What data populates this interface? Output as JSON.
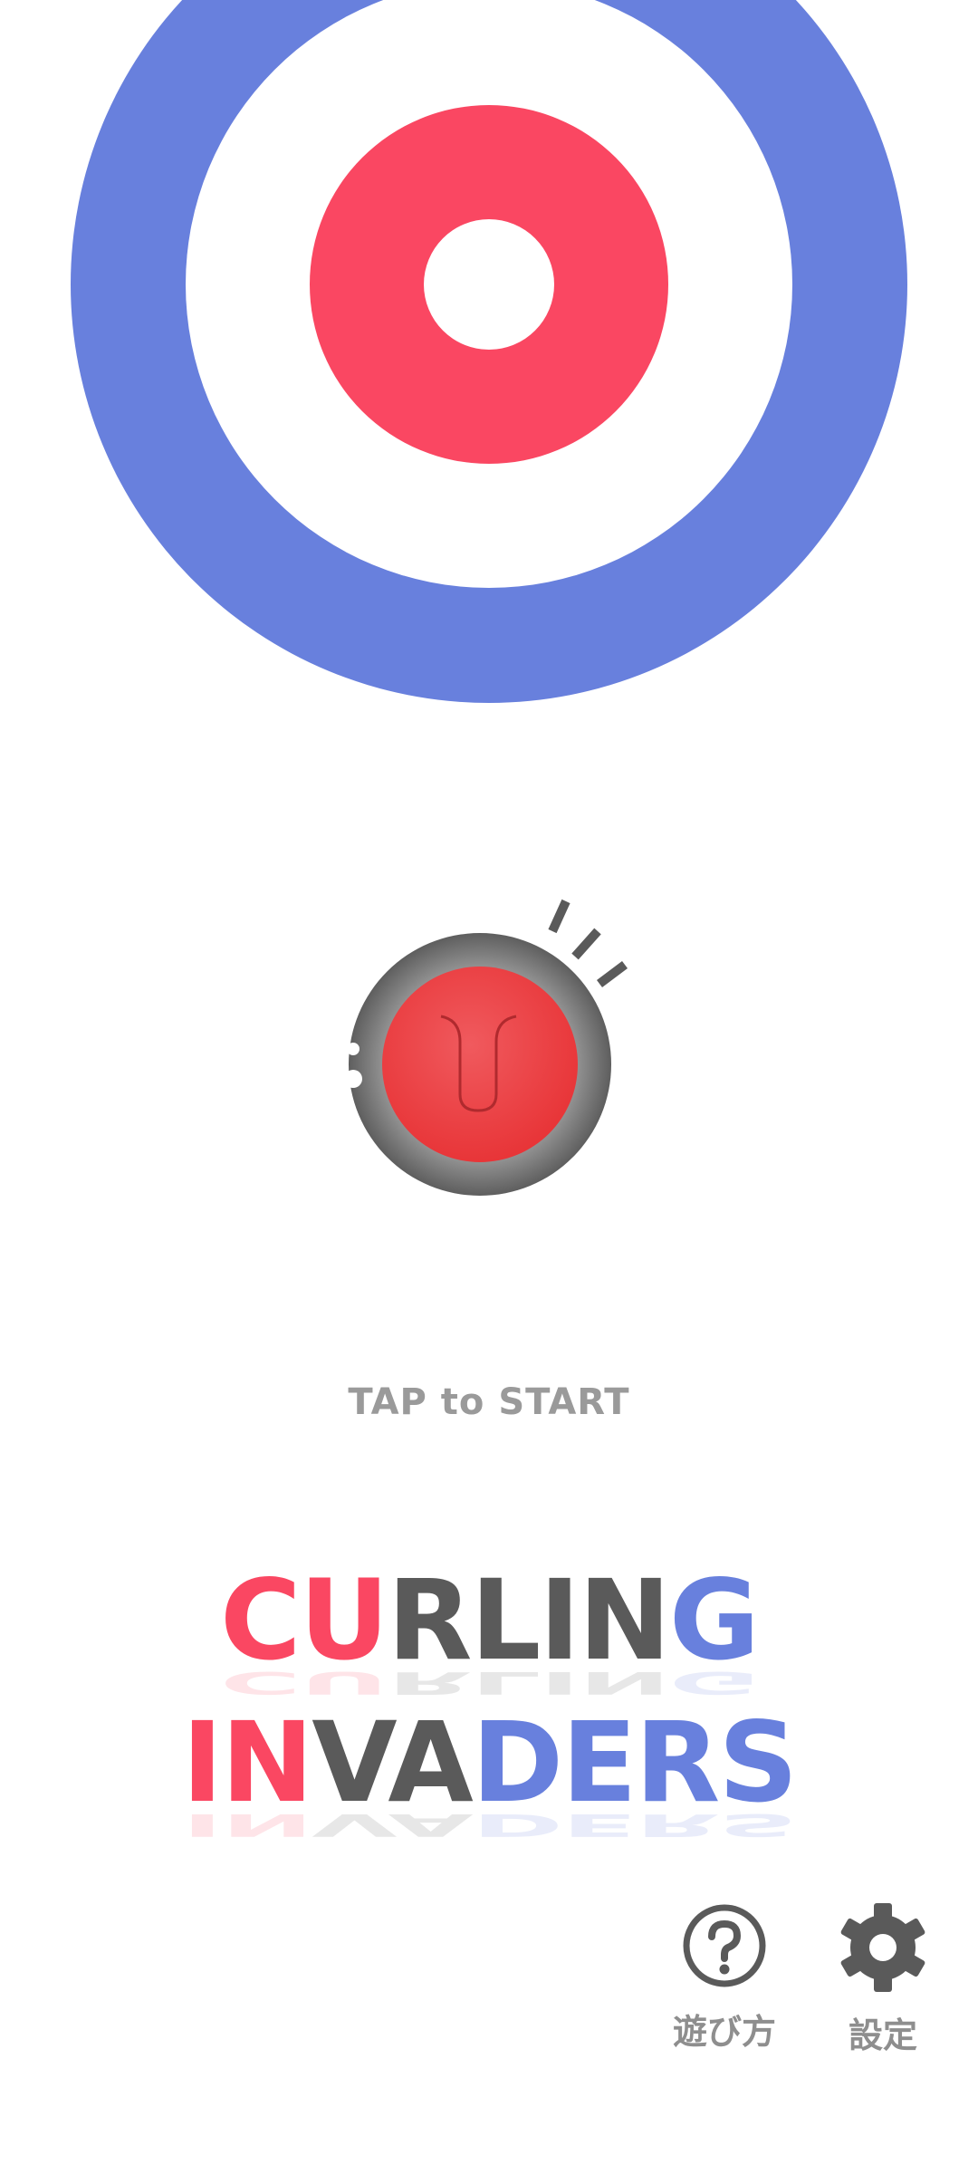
{
  "colors": {
    "house_blue": "#6880dd",
    "house_red": "#fa4762",
    "house_white": "#ffffff",
    "stone_red": "#ee3a3f",
    "stone_gray": "#6a6a6a",
    "title_red": "#fa4762",
    "title_gray": "#5a5a5a",
    "title_blue": "#6880dd",
    "prompt_gray": "#9a9a9a"
  },
  "prompt": {
    "tap_to_start": "TAP to START"
  },
  "title": {
    "line1": {
      "red": "CU",
      "gray": "RLIN",
      "blue": "G"
    },
    "line2": {
      "red": "IN",
      "gray": "VA",
      "blue": "DERS"
    }
  },
  "menu": {
    "howto": {
      "label": "遊び方",
      "icon": "question-circle-icon"
    },
    "settings": {
      "label": "設定",
      "icon": "gear-icon"
    }
  }
}
